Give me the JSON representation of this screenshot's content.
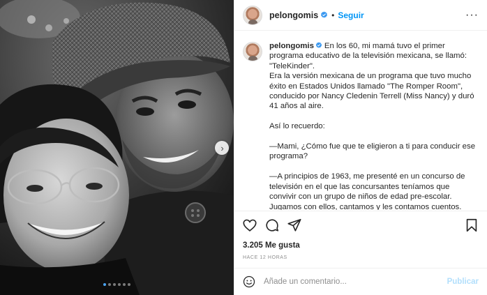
{
  "post": {
    "username": "pelongomis",
    "follow_label": "Seguir",
    "separator": "•",
    "more_label": "···"
  },
  "caption": {
    "username": "pelongomis",
    "text": "En los 60, mi mamá tuvo el primer programa educativo de la televisión mexicana, se llamó: \"TeleKinder\".\nEra la versión mexicana de un programa que tuvo mucho éxito en Estados Unidos llamado \"The Romper Room\", conducido por Nancy Cledenin Terrell (Miss Nancy) y duró 41 años al aire.\n\nAsí lo recuerdo:\n\n—Mami, ¿Cómo fue que te eligieron a ti para conducir ese programa?\n\n—A principios de 1963, me presenté en un concurso de televisión en el que las concursantes teníamos que\nconvivir con un grupo de niños de edad pre-escolar.\nJugamos con ellos, cantamos y les contamos cuentos.\nA los productores y ejecutivos les gustó mucho cómo fui ganándome la confianza de los niños y tomaron la decisión de que yo sería la conductora de la versión mexicana de \"The Romper"
  },
  "stats": {
    "likes": "3.205 Me gusta",
    "timestamp": "HACE 12 HORAS"
  },
  "comment": {
    "placeholder": "Añade un comentario...",
    "publish_label": "Publicar"
  },
  "carousel": {
    "slide_count": 6,
    "current_slide": 1,
    "next_glyph": "›"
  },
  "colors": {
    "accent": "#0095f6",
    "publish_disabled": "#b2dffc",
    "verified": "#3897f0",
    "like": "#262626",
    "active_dot": "#4aa3f0"
  },
  "icons": [
    "verified-badge-icon",
    "heart-icon",
    "comment-icon",
    "share-icon",
    "bookmark-icon",
    "emoji-icon",
    "chevron-right-icon"
  ]
}
